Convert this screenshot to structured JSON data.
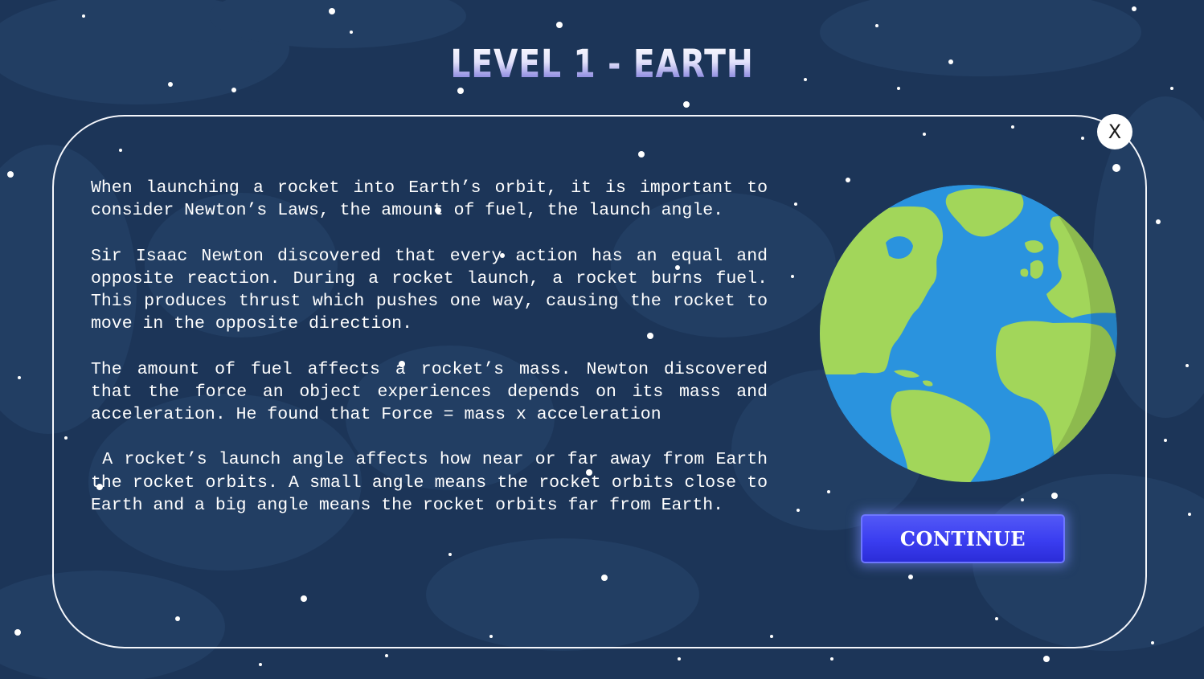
{
  "level": {
    "title": "LEVEL 1 - EARTH"
  },
  "dialog": {
    "close_label": "X",
    "paragraphs": [
      "When launching a rocket into Earth’s orbit, it is important to consider Newton’s Laws, the amount of fuel, the launch angle.",
      "Sir Isaac Newton discovered that every action has an equal and opposite reaction. During a rocket launch, a rocket burns fuel. This produces thrust which pushes one way, causing the rocket to move in the opposite direction.",
      "The amount of fuel affects a rocket’s mass. Newton discovered that the force an object experiences depends on its mass and acceleration. He found that Force = mass x acceleration",
      " A rocket’s launch angle affects how near or far away from Earth the rocket orbits. A small angle means the rocket orbits close to Earth and a big angle means the rocket orbits far from Earth."
    ],
    "continue_label": "CONTINUE"
  },
  "colors": {
    "background": "#1c3558",
    "panel_border": "#f4f6fb",
    "button": "#3a3df0",
    "ocean": "#2a93de",
    "land": "#a2d65a"
  },
  "icons": {
    "close": "close-icon",
    "planet": "earth-globe"
  }
}
